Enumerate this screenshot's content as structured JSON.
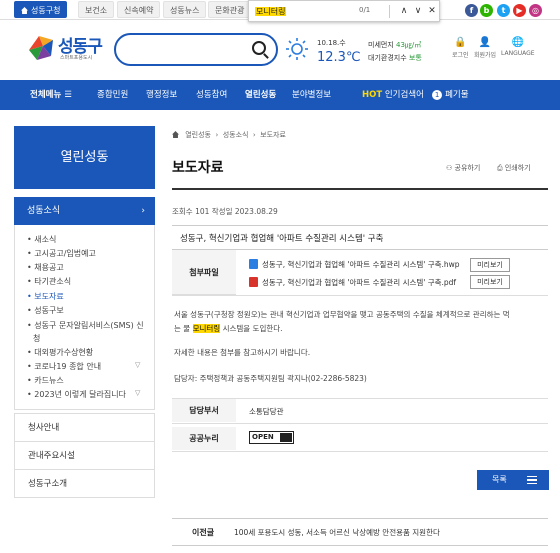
{
  "colors": {
    "primary": "#1a57b8",
    "highlight": "#ffd800",
    "good": "#2a9a3a"
  },
  "topbar": {
    "tabs": [
      "성동구청",
      "보건소",
      "신속예약",
      "성동뉴스",
      "문화관광"
    ],
    "social": [
      {
        "icon": "facebook-icon",
        "label": "f",
        "color": "#3b5998"
      },
      {
        "icon": "blog-icon",
        "label": "b",
        "color": "#2db400"
      },
      {
        "icon": "twitter-icon",
        "label": "t",
        "color": "#1da1f2"
      },
      {
        "icon": "youtube-icon",
        "label": "▶",
        "color": "#e52d27"
      },
      {
        "icon": "instagram-icon",
        "label": "◎",
        "color": "#c13584"
      }
    ]
  },
  "findbar": {
    "query": "모니터링",
    "count": "0/1",
    "prev": "∧",
    "next": "∨",
    "close": "✕"
  },
  "header": {
    "logo_name": "성동구",
    "logo_sub": "스마트포용도시",
    "weather_date": "10.18.수",
    "weather_temp": "12.3℃",
    "dust_label": "미세먼지",
    "dust_value": "43㎍/㎥",
    "air_label": "대기환경지수",
    "air_value": "보통",
    "icons": [
      {
        "name": "login-icon",
        "glyph": "🔒",
        "label": "로그인"
      },
      {
        "name": "signup-icon",
        "glyph": "👤",
        "label": "회원가입"
      },
      {
        "name": "language-icon",
        "glyph": "🌐",
        "label": "LANGUAGE"
      }
    ]
  },
  "nav": {
    "all_menu": "전체메뉴",
    "items": [
      "종합민원",
      "행정정보",
      "성동참여",
      "열린성동",
      "분야별정보"
    ],
    "hot_label": "HOT",
    "hot_title": "인기검색어",
    "hot_rank": "1",
    "hot_keyword": "폐기물"
  },
  "sidebar": {
    "heading": "열린성동",
    "category": "성동소식",
    "category_chevron": "›",
    "items": [
      "새소식",
      "고시공고/입법예고",
      "채용공고",
      "타기관소식",
      "보도자료",
      "성동구보",
      "성동구 문자알림서비스(SMS) 신",
      "청",
      "대외평가수상현황",
      "코로나19 종합 안내",
      "카드뉴스",
      "2023년 이렇게 달라집니다"
    ],
    "boxes": [
      "청사안내",
      "관내주요시설",
      "성동구소개"
    ]
  },
  "breadcrumb": {
    "items": [
      "열린성동",
      "성동소식",
      "보도자료"
    ]
  },
  "page": {
    "title": "보도자료",
    "share": "공유하기",
    "print": "인쇄하기",
    "meta": "조회수 101 작성일 2023.08.29",
    "post_title": "성동구, 혁신기업과 협업해 '아파트 수질관리 시스템' 구축",
    "attach_label": "첨부파일",
    "attachments": [
      {
        "name": "성동구, 혁신기업과 협업해 '아파트 수질관리 시스템' 구축.hwp",
        "preview": "미리보기",
        "color": "#2a7de1"
      },
      {
        "name": "성동구, 혁신기업과 협업해 '아파트 수질관리 시스템' 구축.pdf",
        "preview": "미리보기",
        "color": "#d9342b"
      }
    ],
    "body1a": "서울 성동구(구청장 정원오)는 관내 혁신기업과 업무협약을 맺고 공동주택의 수질을 체계적으로 관리하는 먹",
    "body1b_pre": "는 물 ",
    "body1b_hl": "모니터링",
    "body1b_post": " 시스템을 도입한다.",
    "body2": "자세한 내용은 첨부를 참고하시기 바랍니다.",
    "body3": "담당자: 주택정책과 공동주택지원팀 곽지나(02-2286-5823)",
    "dept_label": "담당부서",
    "dept_value": "소통담당관",
    "open_label": "공공누리",
    "open_badge": "OPEN",
    "list_button": "목록",
    "prev_label": "이전글",
    "prev_text": "100세 포용도시 성동, 서소득 어르신 낙상예방 안전용품 지원한다"
  }
}
